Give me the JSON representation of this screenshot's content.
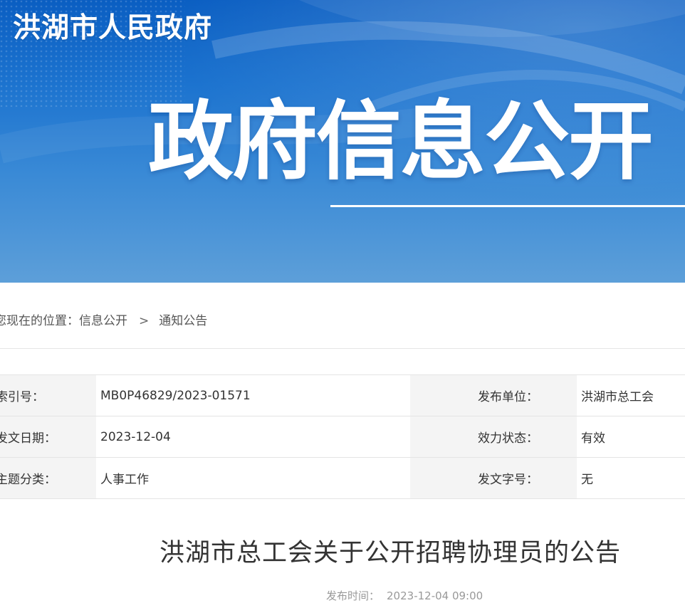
{
  "header": {
    "site_name": "洪湖市人民政府",
    "section_title": "政府信息公开"
  },
  "breadcrumb": {
    "prefix": "您现在的位置：",
    "items": [
      "信息公开",
      "通知公告"
    ],
    "separator": ">"
  },
  "meta": {
    "rows": [
      {
        "label_left": "索引号：",
        "value_left": "MB0P46829/2023-01571",
        "label_right": "发布单位：",
        "value_right": "洪湖市总工会"
      },
      {
        "label_left": "发文日期：",
        "value_left": "2023-12-04",
        "label_right": "效力状态：",
        "value_right": "有效"
      },
      {
        "label_left": "主题分类：",
        "value_left": "人事工作",
        "label_right": "发文字号：",
        "value_right": "无"
      }
    ]
  },
  "article": {
    "title": "洪湖市总工会关于公开招聘协理员的公告",
    "publish_label": "发布时间：",
    "publish_time": "2023-12-04 09:00"
  },
  "colors": {
    "banner_top": "#0a5ec2",
    "banner_bottom": "#5d9fd9",
    "label_bg": "#f4f4f4"
  }
}
